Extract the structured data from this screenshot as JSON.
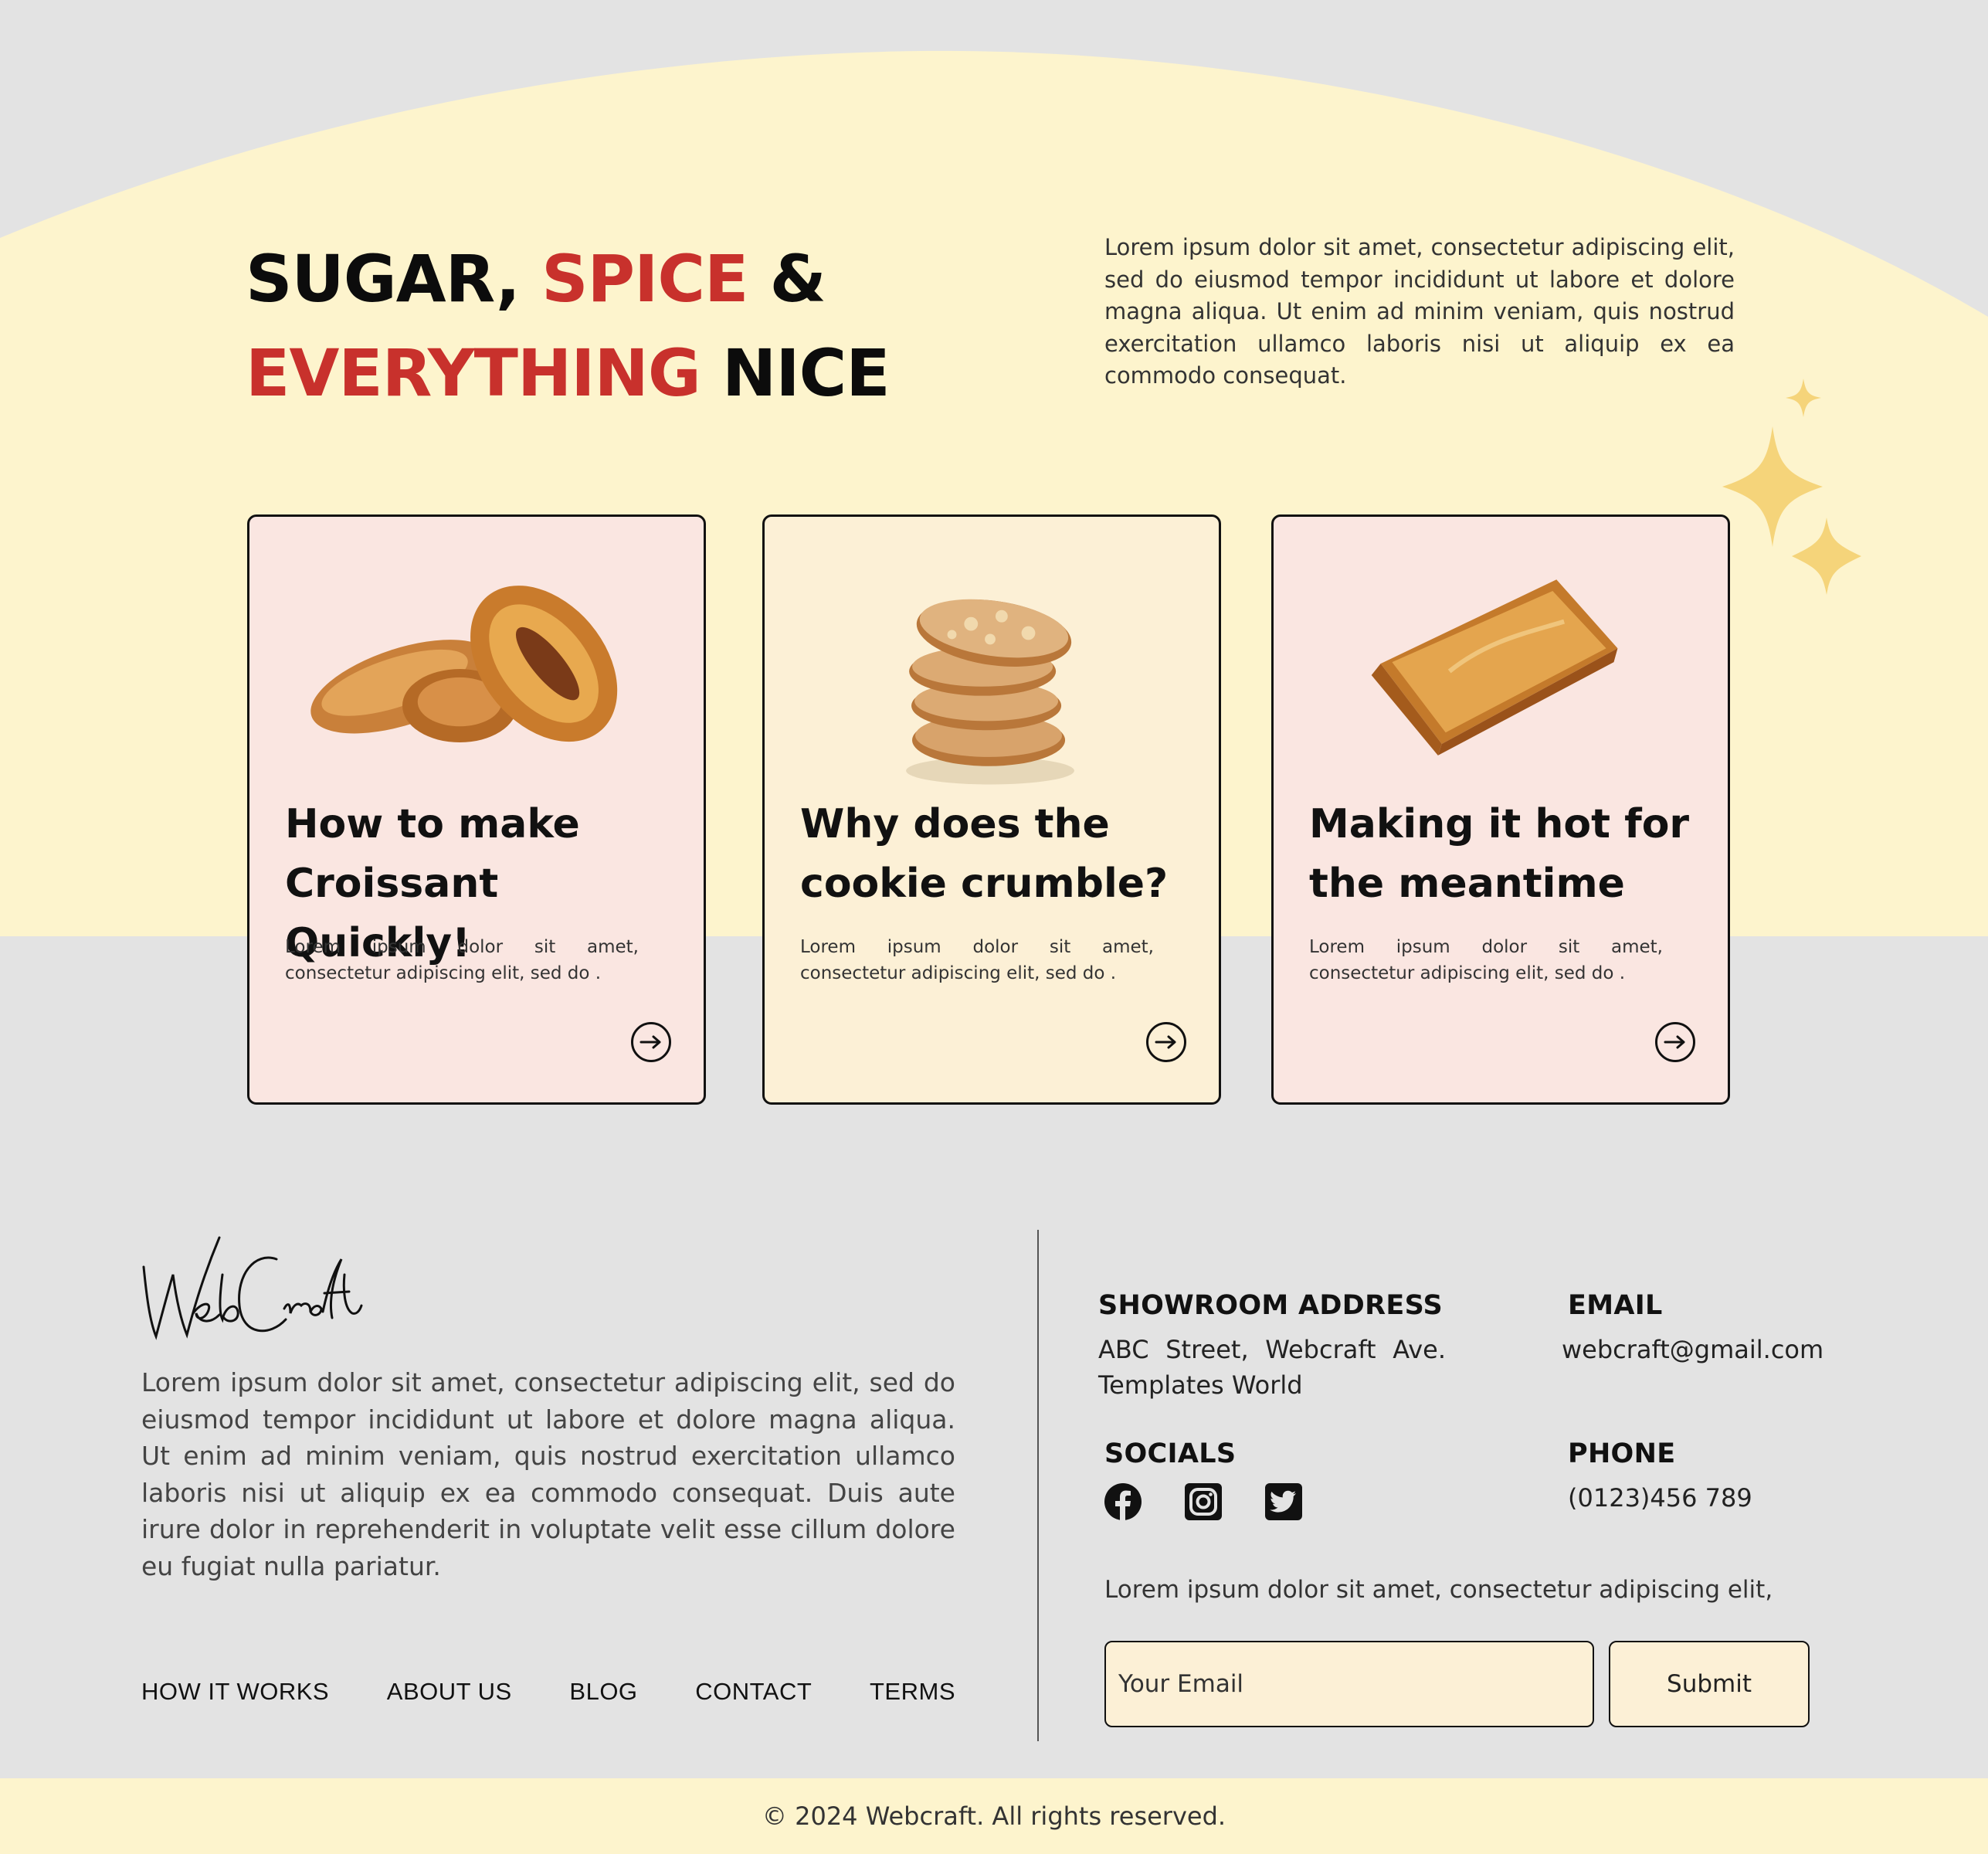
{
  "colors": {
    "accent_red": "#c8312c",
    "cream_yellow": "#fdf4cd",
    "card_pink": "#fae6e1",
    "card_cream": "#fcf0d6",
    "background_gray": "#e3e3e3",
    "sparkle": "#f5d47a"
  },
  "hero": {
    "title_part1": "SUGAR, ",
    "title_part2": "SPICE",
    "title_part3": " &",
    "title_part4": "EVERYTHING",
    "title_part5": " NICE",
    "description": "Lorem ipsum dolor sit amet, consectetur adipiscing elit, sed do eiusmod tempor incididunt ut labore et dolore magna aliqua. Ut enim ad minim veniam, quis nostrud exercitation ullamco laboris nisi ut aliquip ex ea commodo consequat."
  },
  "cards": [
    {
      "title": "How to make Croissant Quickly!",
      "text": "Lorem ipsum dolor sit amet, consectetur adipiscing elit, sed do .",
      "image": "croissant-pastries-image",
      "icon": "arrow-right-icon"
    },
    {
      "title": "Why does the cookie crumble?",
      "text": "Lorem ipsum dolor sit amet, consectetur adipiscing elit, sed do .",
      "image": "cookie-stack-image",
      "icon": "arrow-right-icon"
    },
    {
      "title": "Making it hot for the meantime",
      "text": "Lorem ipsum dolor sit amet, consectetur adipiscing elit, sed do .",
      "image": "puff-pastry-image",
      "icon": "arrow-right-icon"
    }
  ],
  "footer": {
    "logo_text": "WebCraft",
    "about": "Lorem ipsum dolor sit amet, consectetur adipiscing elit, sed do eiusmod tempor incididunt ut labore et dolore magna aliqua. Ut enim ad minim veniam, quis nostrud exercitation ullamco laboris nisi ut aliquip ex ea commodo consequat. Duis aute irure dolor in reprehenderit in voluptate velit esse cillum dolore eu fugiat nulla pariatur.",
    "nav": [
      "HOW IT WORKS",
      "ABOUT US",
      "BLOG",
      "CONTACT",
      "TERMS"
    ],
    "showroom_label": "SHOWROOM ADDRESS",
    "showroom_value": "ABC Street, Webcraft Ave. Templates World",
    "email_label": "EMAIL",
    "email_value": "webcraft@gmail.com",
    "socials_label": "SOCIALS",
    "socials": [
      "facebook-icon",
      "instagram-icon",
      "twitter-icon"
    ],
    "phone_label": "PHONE",
    "phone_value": "(0123)456 789",
    "newsletter_text": "Lorem ipsum dolor sit amet, consectetur adipiscing elit,",
    "email_placeholder": "Your Email",
    "submit_label": "Submit",
    "copyright": "© 2024 Webcraft. All rights reserved."
  }
}
